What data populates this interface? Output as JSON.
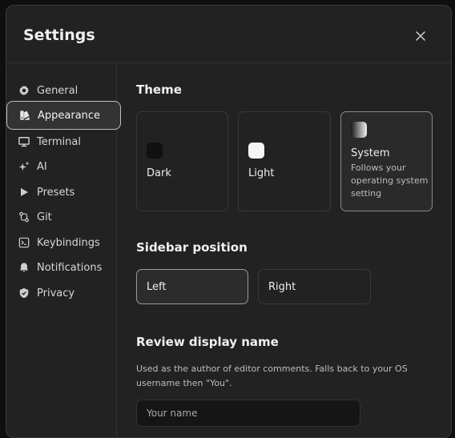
{
  "window": {
    "title": "Settings"
  },
  "sidebar": {
    "items": [
      {
        "label": "General",
        "icon": "gear-icon"
      },
      {
        "label": "Appearance",
        "icon": "palette-icon",
        "active": true
      },
      {
        "label": "Terminal",
        "icon": "monitor-icon"
      },
      {
        "label": "AI",
        "icon": "sparkles-icon"
      },
      {
        "label": "Presets",
        "icon": "play-icon"
      },
      {
        "label": "Git",
        "icon": "git-compare-icon"
      },
      {
        "label": "Keybindings",
        "icon": "terminal-square-icon"
      },
      {
        "label": "Notifications",
        "icon": "bell-icon"
      },
      {
        "label": "Privacy",
        "icon": "shield-check-icon"
      }
    ]
  },
  "theme": {
    "title": "Theme",
    "options": [
      {
        "label": "Dark",
        "swatch": "#111111"
      },
      {
        "label": "Light",
        "swatch": "#f5f5f5"
      },
      {
        "label": "System",
        "description": "Follows your operating system setting",
        "selected": true
      }
    ]
  },
  "sidebar_position": {
    "title": "Sidebar position",
    "options": [
      {
        "label": "Left",
        "selected": true
      },
      {
        "label": "Right"
      }
    ]
  },
  "review_name": {
    "title": "Review display name",
    "help": "Used as the author of editor comments. Falls back to your OS username then \"You\".",
    "placeholder": "Your name",
    "value": ""
  }
}
